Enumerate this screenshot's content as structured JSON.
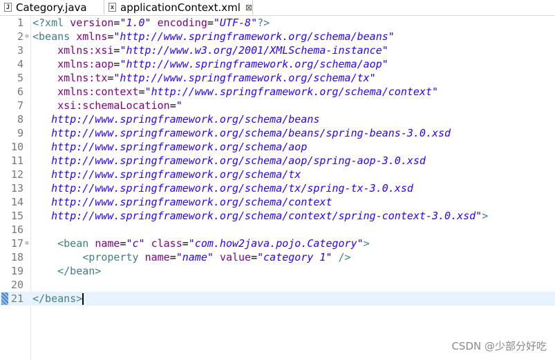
{
  "tabs": [
    {
      "label": "Category.java",
      "icon": "java-file-icon",
      "active": false
    },
    {
      "label": "applicationContext.xml",
      "icon": "xml-file-icon",
      "active": true
    }
  ],
  "tab_close_glyph": "⊠",
  "code_lines": [
    {
      "n": "1",
      "fold": "",
      "parts": [
        [
          "t",
          "<?xml "
        ],
        [
          "a",
          "version"
        ],
        [
          "p",
          "="
        ],
        [
          "v",
          "\"1.0\""
        ],
        [
          "p",
          " "
        ],
        [
          "a",
          "encoding"
        ],
        [
          "p",
          "="
        ],
        [
          "v",
          "\"UTF-8\""
        ],
        [
          "t",
          "?>"
        ]
      ]
    },
    {
      "n": "2",
      "fold": "⊖",
      "parts": [
        [
          "t",
          "<beans "
        ],
        [
          "a",
          "xmlns"
        ],
        [
          "p",
          "="
        ],
        [
          "v",
          "\"http://www.springframework.org/schema/beans\""
        ]
      ]
    },
    {
      "n": "3",
      "fold": "",
      "parts": [
        [
          "p",
          "    "
        ],
        [
          "a",
          "xmlns:xsi"
        ],
        [
          "p",
          "="
        ],
        [
          "v",
          "\"http://www.w3.org/2001/XMLSchema-instance\""
        ]
      ]
    },
    {
      "n": "4",
      "fold": "",
      "parts": [
        [
          "p",
          "    "
        ],
        [
          "a",
          "xmlns:aop"
        ],
        [
          "p",
          "="
        ],
        [
          "v",
          "\"http://www.springframework.org/schema/aop\""
        ]
      ]
    },
    {
      "n": "5",
      "fold": "",
      "parts": [
        [
          "p",
          "    "
        ],
        [
          "a",
          "xmlns:tx"
        ],
        [
          "p",
          "="
        ],
        [
          "v",
          "\"http://www.springframework.org/schema/tx\""
        ]
      ]
    },
    {
      "n": "6",
      "fold": "",
      "parts": [
        [
          "p",
          "    "
        ],
        [
          "a",
          "xmlns:context"
        ],
        [
          "p",
          "="
        ],
        [
          "v",
          "\"http://www.springframework.org/schema/context\""
        ]
      ]
    },
    {
      "n": "7",
      "fold": "",
      "parts": [
        [
          "p",
          "    "
        ],
        [
          "a",
          "xsi:schemaLocation"
        ],
        [
          "p",
          "="
        ],
        [
          "v",
          "\""
        ]
      ]
    },
    {
      "n": "8",
      "fold": "",
      "parts": [
        [
          "p",
          "   "
        ],
        [
          "v",
          "http://www.springframework.org/schema/beans"
        ]
      ]
    },
    {
      "n": "9",
      "fold": "",
      "parts": [
        [
          "p",
          "   "
        ],
        [
          "v",
          "http://www.springframework.org/schema/beans/spring-beans-3.0.xsd"
        ]
      ]
    },
    {
      "n": "10",
      "fold": "",
      "parts": [
        [
          "p",
          "   "
        ],
        [
          "v",
          "http://www.springframework.org/schema/aop"
        ]
      ]
    },
    {
      "n": "11",
      "fold": "",
      "parts": [
        [
          "p",
          "   "
        ],
        [
          "v",
          "http://www.springframework.org/schema/aop/spring-aop-3.0.xsd"
        ]
      ]
    },
    {
      "n": "12",
      "fold": "",
      "parts": [
        [
          "p",
          "   "
        ],
        [
          "v",
          "http://www.springframework.org/schema/tx"
        ]
      ]
    },
    {
      "n": "13",
      "fold": "",
      "parts": [
        [
          "p",
          "   "
        ],
        [
          "v",
          "http://www.springframework.org/schema/tx/spring-tx-3.0.xsd"
        ]
      ]
    },
    {
      "n": "14",
      "fold": "",
      "parts": [
        [
          "p",
          "   "
        ],
        [
          "v",
          "http://www.springframework.org/schema/context"
        ]
      ]
    },
    {
      "n": "15",
      "fold": "",
      "parts": [
        [
          "p",
          "   "
        ],
        [
          "v",
          "http://www.springframework.org/schema/context/spring-context-3.0.xsd\""
        ],
        [
          "t",
          ">"
        ]
      ]
    },
    {
      "n": "16",
      "fold": "",
      "parts": []
    },
    {
      "n": "17",
      "fold": "⊖",
      "parts": [
        [
          "p",
          "    "
        ],
        [
          "t",
          "<bean "
        ],
        [
          "a",
          "name"
        ],
        [
          "p",
          "="
        ],
        [
          "v",
          "\"c\""
        ],
        [
          "p",
          " "
        ],
        [
          "a",
          "class"
        ],
        [
          "p",
          "="
        ],
        [
          "v",
          "\"com.how2java.pojo.Category\""
        ],
        [
          "t",
          ">"
        ]
      ]
    },
    {
      "n": "18",
      "fold": "",
      "parts": [
        [
          "p",
          "        "
        ],
        [
          "t",
          "<property "
        ],
        [
          "a",
          "name"
        ],
        [
          "p",
          "="
        ],
        [
          "v",
          "\"name\""
        ],
        [
          "p",
          " "
        ],
        [
          "a",
          "value"
        ],
        [
          "p",
          "="
        ],
        [
          "v",
          "\"category 1\""
        ],
        [
          "p",
          " "
        ],
        [
          "t",
          "/>"
        ]
      ]
    },
    {
      "n": "19",
      "fold": "",
      "parts": [
        [
          "p",
          "    "
        ],
        [
          "t",
          "</bean>"
        ]
      ]
    },
    {
      "n": "20",
      "fold": "",
      "parts": []
    },
    {
      "n": "21",
      "fold": "",
      "current": true,
      "parts": [
        [
          "t",
          "</beans>"
        ]
      ]
    }
  ],
  "watermark": "CSDN @少部分好吃",
  "colors": {
    "tag": "#3f7f7f",
    "attribute": "#7f007f",
    "value": "#2a00ff",
    "current_line": "#e8f2fe"
  }
}
